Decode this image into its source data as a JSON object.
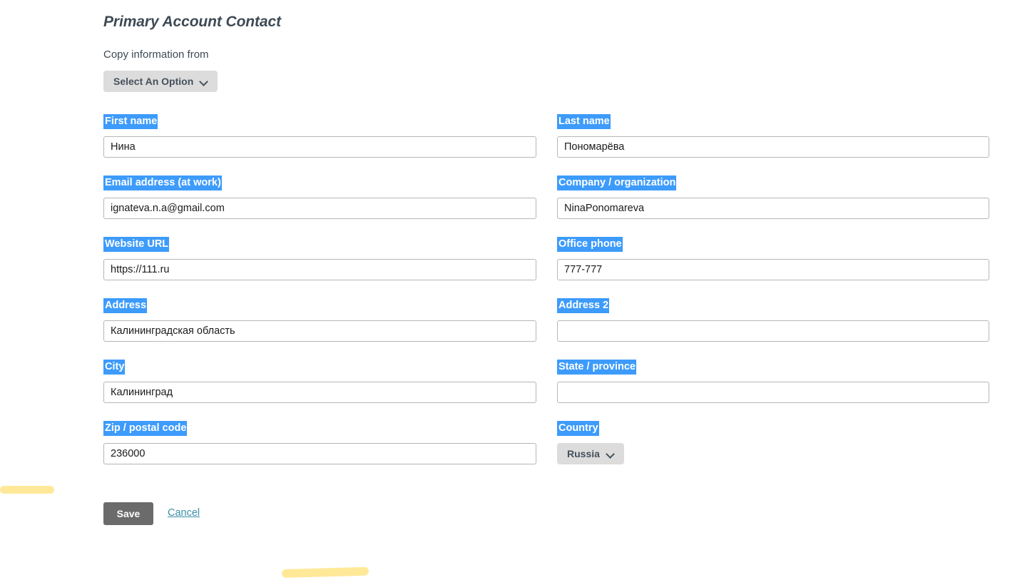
{
  "header": {
    "title": "Primary Account Contact"
  },
  "copy_from": {
    "label": "Copy information from",
    "selected": "Select An Option",
    "chevron_icon": "chevron-down-icon"
  },
  "fields": [
    {
      "key": "first_name",
      "label": "First name",
      "value": "Нина",
      "placeholder": "",
      "column": "left",
      "row": 1
    },
    {
      "key": "last_name",
      "label": "Last name",
      "value": "Пономарёва",
      "placeholder": "",
      "column": "right",
      "row": 1
    },
    {
      "key": "email",
      "label": "Email address (at work)",
      "value": "ignateva.n.a@gmail.com",
      "placeholder": "",
      "column": "left",
      "row": 2
    },
    {
      "key": "company",
      "label": "Company / organization",
      "value": "NinaPonomareva",
      "placeholder": "",
      "column": "right",
      "row": 2
    },
    {
      "key": "website",
      "label": "Website URL",
      "value": "https://111.ru",
      "placeholder": "",
      "column": "left",
      "row": 3
    },
    {
      "key": "office_phone",
      "label": "Office phone",
      "value": "777-777",
      "placeholder": "",
      "column": "right",
      "row": 3
    },
    {
      "key": "address",
      "label": "Address",
      "value": "Калининградская область",
      "placeholder": "",
      "column": "left",
      "row": 4
    },
    {
      "key": "address2",
      "label": "Address 2",
      "value": "",
      "placeholder": "",
      "column": "right",
      "row": 4
    },
    {
      "key": "city",
      "label": "City",
      "value": "Калининград",
      "placeholder": "",
      "column": "left",
      "row": 5
    },
    {
      "key": "state",
      "label": "State / province",
      "value": "",
      "placeholder": "",
      "column": "right",
      "row": 5
    },
    {
      "key": "zip",
      "label": "Zip / postal code",
      "value": "236000",
      "placeholder": "",
      "column": "left",
      "row": 6
    }
  ],
  "country": {
    "label": "Country",
    "selected": "Russia",
    "chevron_icon": "chevron-down-icon"
  },
  "actions": {
    "save_label": "Save",
    "cancel_label": "Cancel"
  },
  "annotations": {
    "marker_left": "highlighter-mark",
    "marker_bottom": "highlighter-mark"
  },
  "colors": {
    "label_highlight": "#3d9bfb",
    "label_highlight_text": "#ffffff",
    "title_text": "#3e4a54",
    "save_button_bg": "#6b6b6b",
    "cancel_link": "#3b8fa9",
    "pill_bg": "#dcdcdc",
    "input_border": "#b6b6b6",
    "marker_yellow": "#ffe999",
    "page_bg": "#ffffff"
  }
}
